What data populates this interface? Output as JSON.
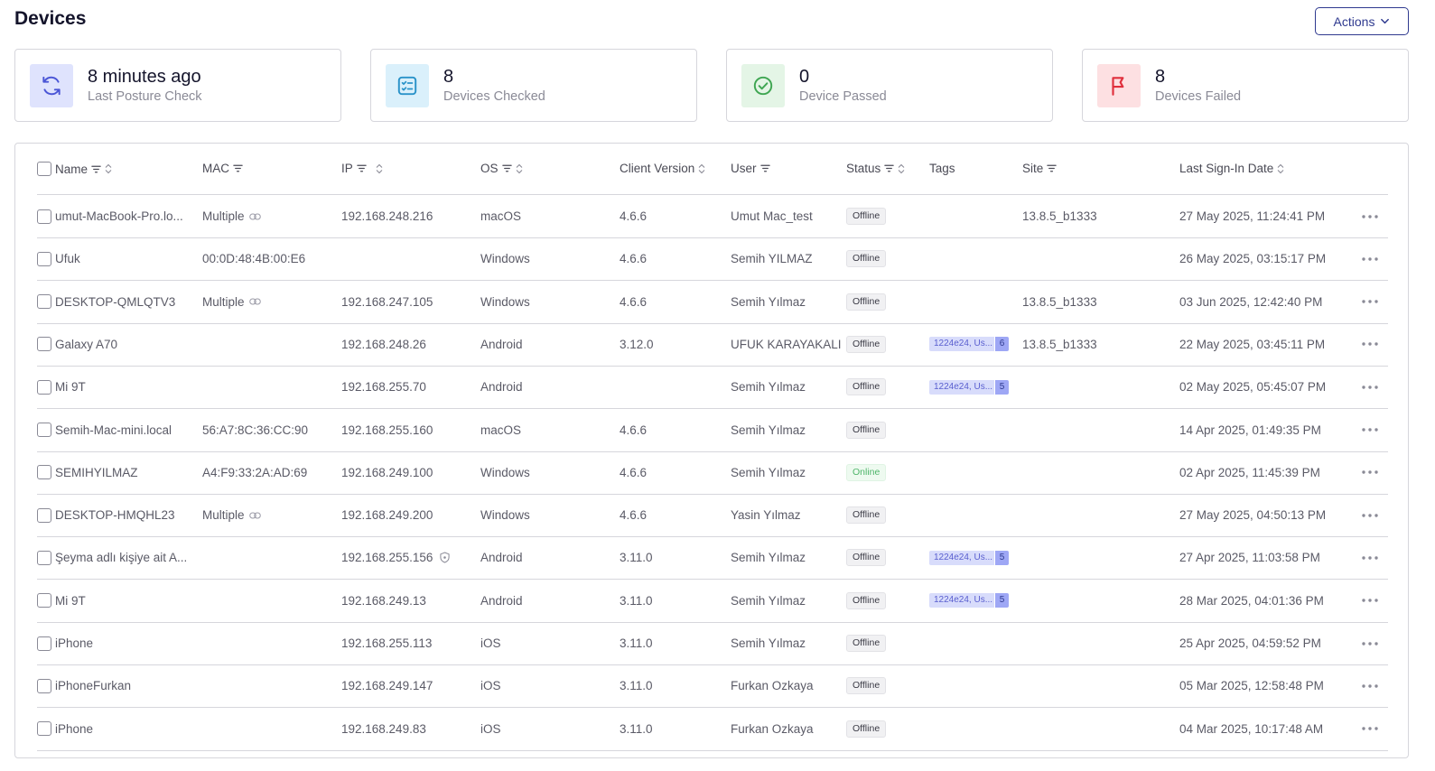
{
  "page": {
    "title": "Devices",
    "actions_label": "Actions"
  },
  "stats": [
    {
      "value": "8 minutes ago",
      "label": "Last Posture Check",
      "icon": "refresh-icon",
      "bg": "#dfe3fd",
      "color": "#4a55d6"
    },
    {
      "value": "8",
      "label": "Devices Checked",
      "icon": "checklist-icon",
      "bg": "#daf0fb",
      "color": "#2a93c9"
    },
    {
      "value": "0",
      "label": "Device Passed",
      "icon": "check-circle-icon",
      "bg": "#e4f5e6",
      "color": "#3fa652"
    },
    {
      "value": "8",
      "label": "Devices Failed",
      "icon": "flag-icon",
      "bg": "#fde0e2",
      "color": "#e0303d"
    }
  ],
  "columns": {
    "name": "Name",
    "mac": "MAC",
    "ip": "IP",
    "os": "OS",
    "client_version": "Client Version",
    "user": "User",
    "status": "Status",
    "tags": "Tags",
    "site": "Site",
    "last_sign_in": "Last Sign-In Date"
  },
  "rows": [
    {
      "name": "umut-MacBook-Pro.lo...",
      "mac": "Multiple",
      "mac_link": true,
      "ip": "192.168.248.216",
      "os": "macOS",
      "client_version": "4.6.6",
      "user": "Umut Mac_test",
      "status": "Offline",
      "tag_label": "",
      "tag_count": "",
      "site": "13.8.5_b1333",
      "last_sign_in": "27 May 2025, 11:24:41 PM"
    },
    {
      "name": "Ufuk",
      "mac": "00:0D:48:4B:00:E6",
      "mac_link": false,
      "ip": "",
      "os": "Windows",
      "client_version": "4.6.6",
      "user": "Semih YILMAZ",
      "status": "Offline",
      "tag_label": "",
      "tag_count": "",
      "site": "",
      "last_sign_in": "26 May 2025, 03:15:17 PM"
    },
    {
      "name": "DESKTOP-QMLQTV3",
      "mac": "Multiple",
      "mac_link": true,
      "ip": "192.168.247.105",
      "os": "Windows",
      "client_version": "4.6.6",
      "user": "Semih Yılmaz",
      "status": "Offline",
      "tag_label": "",
      "tag_count": "",
      "site": "13.8.5_b1333",
      "last_sign_in": "03 Jun 2025, 12:42:40 PM"
    },
    {
      "name": "Galaxy A70",
      "mac": "",
      "mac_link": false,
      "ip": "192.168.248.26",
      "os": "Android",
      "client_version": "3.12.0",
      "user": "UFUK KARAYAKALI",
      "status": "Offline",
      "tag_label": "1224e24, Us...",
      "tag_count": "6",
      "site": "13.8.5_b1333",
      "last_sign_in": "22 May 2025, 03:45:11 PM"
    },
    {
      "name": "Mi 9T",
      "mac": "",
      "mac_link": false,
      "ip": "192.168.255.70",
      "os": "Android",
      "client_version": "",
      "user": "Semih Yılmaz",
      "status": "Offline",
      "tag_label": "1224e24, Us...",
      "tag_count": "5",
      "site": "",
      "last_sign_in": "02 May 2025, 05:45:07 PM"
    },
    {
      "name": "Semih-Mac-mini.local",
      "mac": "56:A7:8C:36:CC:90",
      "mac_link": false,
      "ip": "192.168.255.160",
      "os": "macOS",
      "client_version": "4.6.6",
      "user": "Semih Yılmaz",
      "status": "Offline",
      "tag_label": "",
      "tag_count": "",
      "site": "",
      "last_sign_in": "14 Apr 2025, 01:49:35 PM"
    },
    {
      "name": "SEMIHYILMAZ",
      "mac": "A4:F9:33:2A:AD:69",
      "mac_link": false,
      "ip": "192.168.249.100",
      "os": "Windows",
      "client_version": "4.6.6",
      "user": "Semih Yılmaz",
      "status": "Online",
      "tag_label": "",
      "tag_count": "",
      "site": "",
      "last_sign_in": "02 Apr 2025, 11:45:39 PM"
    },
    {
      "name": "DESKTOP-HMQHL23",
      "mac": "Multiple",
      "mac_link": true,
      "ip": "192.168.249.200",
      "os": "Windows",
      "client_version": "4.6.6",
      "user": "Yasin Yılmaz",
      "status": "Offline",
      "tag_label": "",
      "tag_count": "",
      "site": "",
      "last_sign_in": "27 May 2025, 04:50:13 PM"
    },
    {
      "name": "Şeyma adlı kişiye ait A...",
      "mac": "",
      "mac_link": false,
      "ip": "192.168.255.156",
      "ip_shield": true,
      "os": "Android",
      "client_version": "3.11.0",
      "user": "Semih Yılmaz",
      "status": "Offline",
      "tag_label": "1224e24, Us...",
      "tag_count": "5",
      "site": "",
      "last_sign_in": "27 Apr 2025, 11:03:58 PM"
    },
    {
      "name": "Mi 9T",
      "mac": "",
      "mac_link": false,
      "ip": "192.168.249.13",
      "os": "Android",
      "client_version": "3.11.0",
      "user": "Semih Yılmaz",
      "status": "Offline",
      "tag_label": "1224e24, Us...",
      "tag_count": "5",
      "site": "",
      "last_sign_in": "28 Mar 2025, 04:01:36 PM"
    },
    {
      "name": "iPhone",
      "mac": "",
      "mac_link": false,
      "ip": "192.168.255.113",
      "os": "iOS",
      "client_version": "3.11.0",
      "user": "Semih Yılmaz",
      "status": "Offline",
      "tag_label": "",
      "tag_count": "",
      "site": "",
      "last_sign_in": "25 Apr 2025, 04:59:52 PM"
    },
    {
      "name": "iPhoneFurkan",
      "mac": "",
      "mac_link": false,
      "ip": "192.168.249.147",
      "os": "iOS",
      "client_version": "3.11.0",
      "user": "Furkan Ozkaya",
      "status": "Offline",
      "tag_label": "",
      "tag_count": "",
      "site": "",
      "last_sign_in": "05 Mar 2025, 12:58:48 PM"
    },
    {
      "name": "iPhone",
      "mac": "",
      "mac_link": false,
      "ip": "192.168.249.83",
      "os": "iOS",
      "client_version": "3.11.0",
      "user": "Furkan Ozkaya",
      "status": "Offline",
      "tag_label": "",
      "tag_count": "",
      "site": "",
      "last_sign_in": "04 Mar 2025, 10:17:48 AM"
    }
  ]
}
